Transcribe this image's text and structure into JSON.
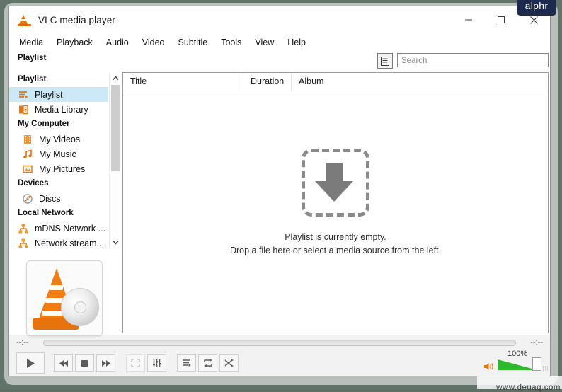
{
  "window": {
    "title": "VLC media player",
    "app_icon": "vlc-cone-icon",
    "controls": {
      "minimize": "minimize-icon",
      "maximize": "maximize-icon",
      "close": "close-icon"
    }
  },
  "watermarks": {
    "brand_badge": "alphr",
    "footer": "www.deuaq.com"
  },
  "menubar": {
    "items": [
      "Media",
      "Playback",
      "Audio",
      "Video",
      "Subtitle",
      "Tools",
      "View",
      "Help"
    ]
  },
  "toolbar": {
    "panel_label": "Playlist",
    "list_view_button": "list-view-icon",
    "search": {
      "placeholder": "Search",
      "value": ""
    }
  },
  "sidebar": {
    "groups": [
      {
        "label": "Playlist",
        "items": [
          {
            "label": "Playlist",
            "icon": "playlist-icon",
            "selected": true
          },
          {
            "label": "Media Library",
            "icon": "media-library-icon",
            "selected": false
          }
        ]
      },
      {
        "label": "My Computer",
        "items": [
          {
            "label": "My Videos",
            "icon": "film-icon",
            "selected": false
          },
          {
            "label": "My Music",
            "icon": "music-note-icon",
            "selected": false
          },
          {
            "label": "My Pictures",
            "icon": "picture-icon",
            "selected": false
          }
        ]
      },
      {
        "label": "Devices",
        "items": [
          {
            "label": "Discs",
            "icon": "disc-icon",
            "selected": false
          }
        ]
      },
      {
        "label": "Local Network",
        "items": [
          {
            "label": "mDNS Network ...",
            "icon": "network-icon",
            "selected": false
          },
          {
            "label": "Network stream...",
            "icon": "network-icon",
            "selected": false
          }
        ]
      }
    ],
    "scroll_up": "chevron-up-icon",
    "scroll_down": "chevron-down-icon",
    "logo": "vlc-cone-logo"
  },
  "playlist": {
    "columns": [
      "Title",
      "Duration",
      "Album"
    ],
    "rows": [],
    "empty_title": "Playlist is currently empty.",
    "empty_hint": "Drop a file here or select a media source from the left.",
    "drop_icon": "download-arrow-icon"
  },
  "player": {
    "time_elapsed": "--:--",
    "time_total": "--:--",
    "progress_percent": 0,
    "buttons": [
      {
        "name": "play",
        "icon": "play-icon",
        "enabled": true
      },
      {
        "name": "previous",
        "icon": "previous-icon",
        "enabled": true
      },
      {
        "name": "stop",
        "icon": "stop-icon",
        "enabled": true
      },
      {
        "name": "next",
        "icon": "next-icon",
        "enabled": true
      },
      {
        "name": "fullscreen",
        "icon": "fullscreen-icon",
        "enabled": false
      },
      {
        "name": "equalizer",
        "icon": "equalizer-icon",
        "enabled": true
      },
      {
        "name": "toggle-playlist",
        "icon": "playlist-toggle-icon",
        "enabled": true
      },
      {
        "name": "loop",
        "icon": "loop-icon",
        "enabled": true
      },
      {
        "name": "shuffle",
        "icon": "shuffle-icon",
        "enabled": true
      }
    ],
    "volume": {
      "label": "100%",
      "level": 100,
      "icon": "speaker-icon"
    }
  },
  "colors": {
    "accent_orange": "#e8740c",
    "selection_blue": "#cde8f7",
    "volume_green": "#2db82d",
    "badge_navy": "#1d2a4d",
    "desktop": "#62736a"
  }
}
